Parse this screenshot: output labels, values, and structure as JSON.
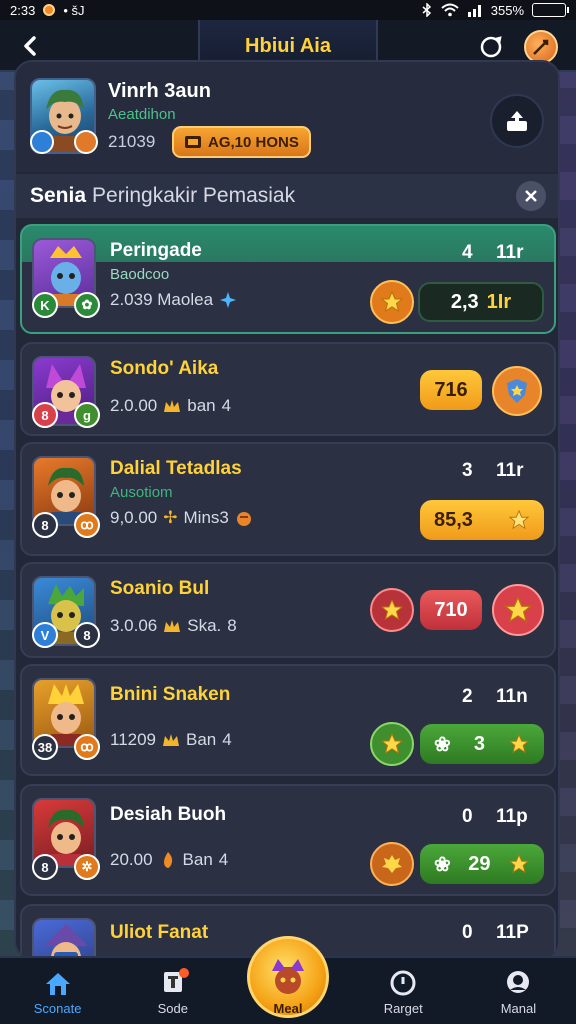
{
  "status_bar": {
    "time": "2:33",
    "extra": "• šJ",
    "battery": "355%"
  },
  "header": {
    "title": "Hbiui Aia"
  },
  "profile": {
    "name": "Vinrh 3aun",
    "subtitle": "Aeatdihon",
    "score": "21039",
    "bonus_label": "AG,10 HONS"
  },
  "section": {
    "title_bold": "Senia",
    "title_rest": "Peringkakir Pemasiak"
  },
  "rows": [
    {
      "title": "Peringade",
      "subtitle": "Baodcoo",
      "stats": "2.039 Maolea",
      "rank": "4",
      "tier": "11r",
      "pill_value": "2,3",
      "pill_suffix": "1Ir"
    },
    {
      "title": "Sondo' Aika",
      "stats": "2.0.00",
      "stats_unit": "ban",
      "stats_num": "4",
      "pill_value": "716"
    },
    {
      "title": "Dalial Tetadlas",
      "subtitle": "Ausotiom",
      "stats": "9,0.00",
      "stats_unit": "Mins3",
      "rank": "3",
      "tier": "11r",
      "pill_value": "85,3"
    },
    {
      "title": "Soanio Bul",
      "stats": "3.0.06",
      "stats_unit": "Ska.",
      "stats_num": "8",
      "pill_value": "710"
    },
    {
      "title": "Bnini Snaken",
      "stats": "11209",
      "stats_unit": "Ban",
      "stats_num": "4",
      "rank": "2",
      "tier": "11n",
      "pill_value": "3"
    },
    {
      "title": "Desiah Buoh",
      "stats": "20.00",
      "stats_unit": "Ban",
      "stats_num": "4",
      "rank": "0",
      "tier": "11p",
      "pill_value": "29"
    },
    {
      "title": "Uliot Fanat",
      "rank": "0",
      "tier": "11P"
    }
  ],
  "bottom_nav": [
    {
      "label": "Sconate",
      "icon": "home-icon"
    },
    {
      "label": "Sode",
      "icon": "trophy-icon"
    },
    {
      "label": "Meal",
      "icon": "character-icon"
    },
    {
      "label": "Rarget",
      "icon": "clock-icon"
    },
    {
      "label": "Manal",
      "icon": "chat-icon"
    }
  ],
  "colors": {
    "accent_gold": "#ffd23a",
    "highlight_green": "#2a8a6c",
    "orange": "#f59a23",
    "red": "#d8404a",
    "green": "#3f8f2e"
  }
}
